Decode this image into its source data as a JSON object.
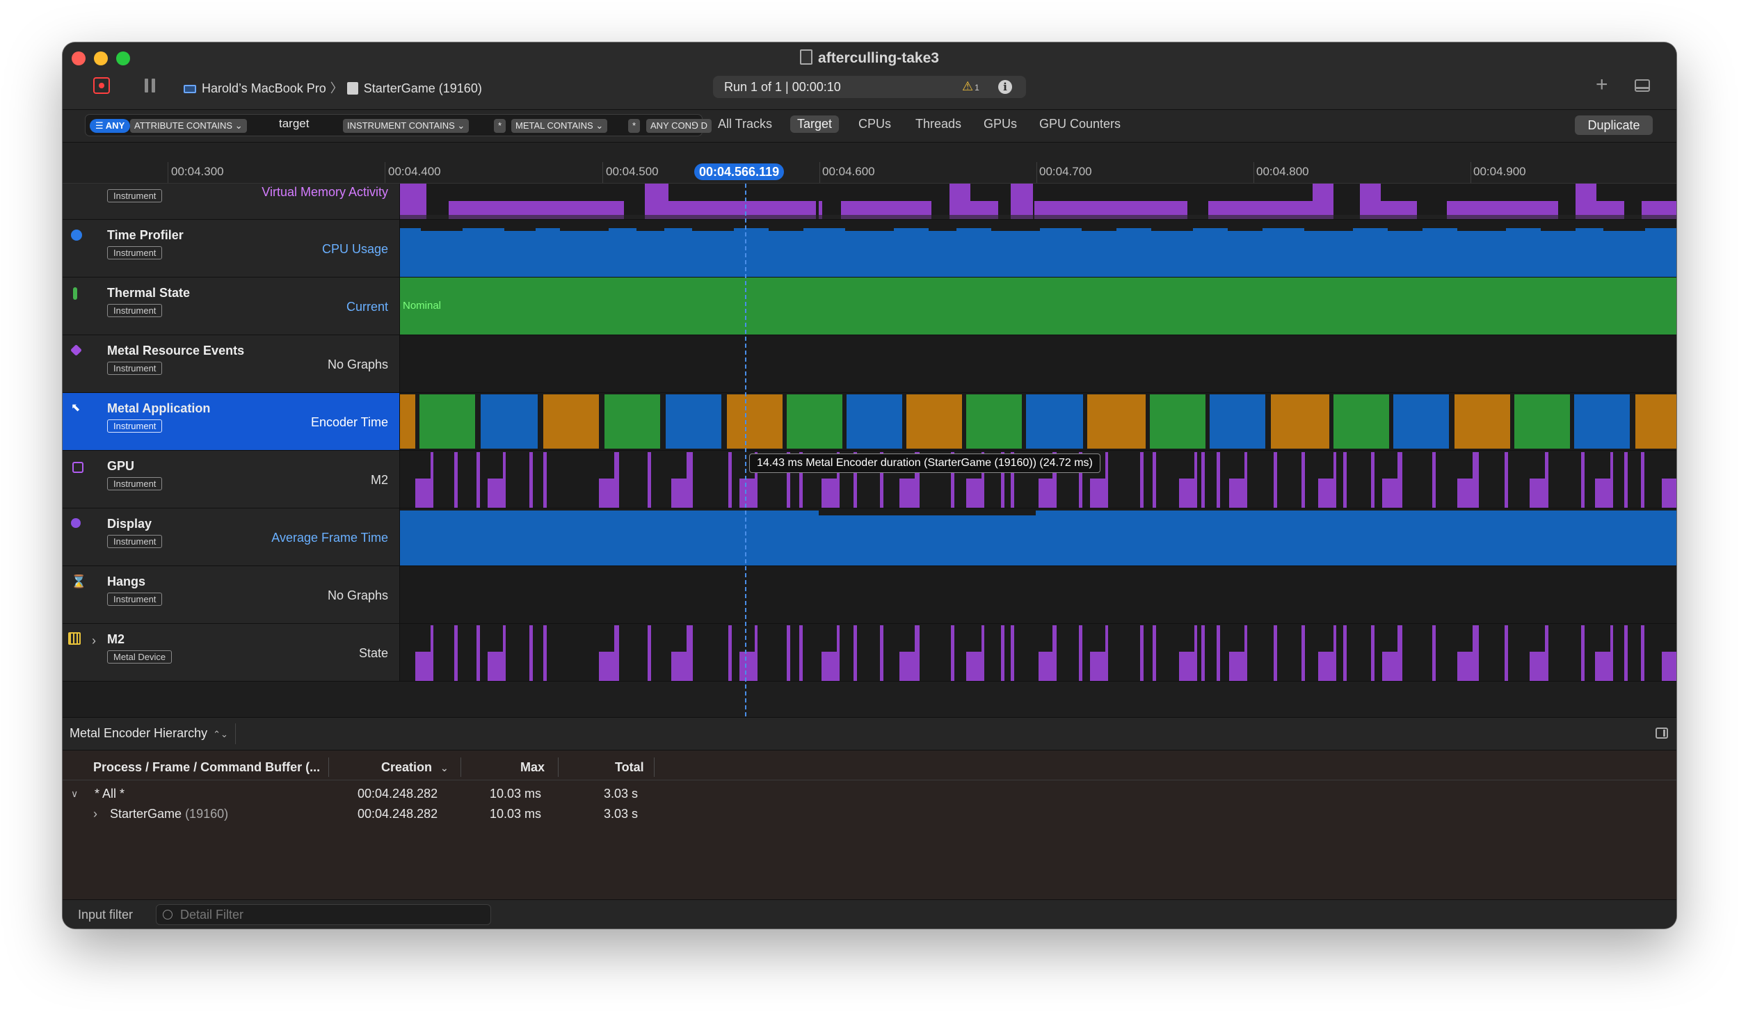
{
  "window": {
    "title": "afterculling-take3",
    "device": "Harold’s MacBook Pro",
    "process": "StarterGame (19160)",
    "run": "Run 1 of 1  |  00:00:10",
    "warning_count": "1"
  },
  "filter": {
    "any": "ANY",
    "chips": [
      {
        "label": "ATTRIBUTE CONTAINS ⌄",
        "value": "target"
      },
      {
        "label": "INSTRUMENT CONTAINS ⌄",
        "value": "*"
      },
      {
        "label": "METAL CONTAINS ⌄",
        "value": "*"
      },
      {
        "label": "ANY CON⅁ D",
        "value": ""
      }
    ],
    "scopes": [
      "All Tracks",
      "Target",
      "CPUs",
      "Threads",
      "GPUs",
      "GPU Counters"
    ],
    "active_scope": "Target",
    "duplicate_label": "Duplicate"
  },
  "ruler": {
    "ticks": [
      "00:04.300",
      "00:04.400",
      "00:04.500",
      "00:04.600",
      "00:04.700",
      "00:04.800",
      "00:04.900"
    ],
    "cursor": "00:04.566.119"
  },
  "tracks": [
    {
      "name": "",
      "badge": "Instrument",
      "graph_label": "Virtual Memory Activity"
    },
    {
      "name": "Time Profiler",
      "badge": "Instrument",
      "graph_label": "CPU Usage"
    },
    {
      "name": "Thermal State",
      "badge": "Instrument",
      "graph_label": "Current",
      "value_label": "Nominal"
    },
    {
      "name": "Metal Resource Events",
      "badge": "Instrument",
      "graph_label": "No Graphs"
    },
    {
      "name": "Metal Application",
      "badge": "Instrument",
      "graph_label": "Encoder Time"
    },
    {
      "name": "GPU",
      "badge": "Instrument",
      "graph_label": "M2"
    },
    {
      "name": "Display",
      "badge": "Instrument",
      "graph_label": "Average Frame Time"
    },
    {
      "name": "Hangs",
      "badge": "Instrument",
      "graph_label": "No Graphs"
    },
    {
      "name": "M2",
      "badge": "Metal Device",
      "graph_label": "State"
    }
  ],
  "tooltip": "14.43 ms Metal Encoder duration (StarterGame (19160)) (24.72 ms)",
  "detail": {
    "hierarchy": "Metal Encoder Hierarchy",
    "columns": {
      "process": "Process / Frame / Command Buffer (...",
      "creation": "Creation",
      "max": "Max",
      "total": "Total"
    },
    "rows": [
      {
        "name": "* All *",
        "pid": "",
        "creation": "00:04.248.282",
        "max": "10.03 ms",
        "total": "3.03 s"
      },
      {
        "name": "StarterGame",
        "pid": "(19160)",
        "creation": "00:04.248.282",
        "max": "10.03 ms",
        "total": "3.03 s"
      }
    ]
  },
  "footer": {
    "input_label": "Input filter",
    "placeholder": "Detail Filter"
  },
  "colors": {
    "accent": "#1d6de0",
    "memory": "#8e3fc4",
    "cpu": "#1462b8",
    "thermal": "#2b9337",
    "encoder_orange": "#b8740f",
    "encoder_green": "#2b9337",
    "encoder_blue": "#1462b8"
  }
}
